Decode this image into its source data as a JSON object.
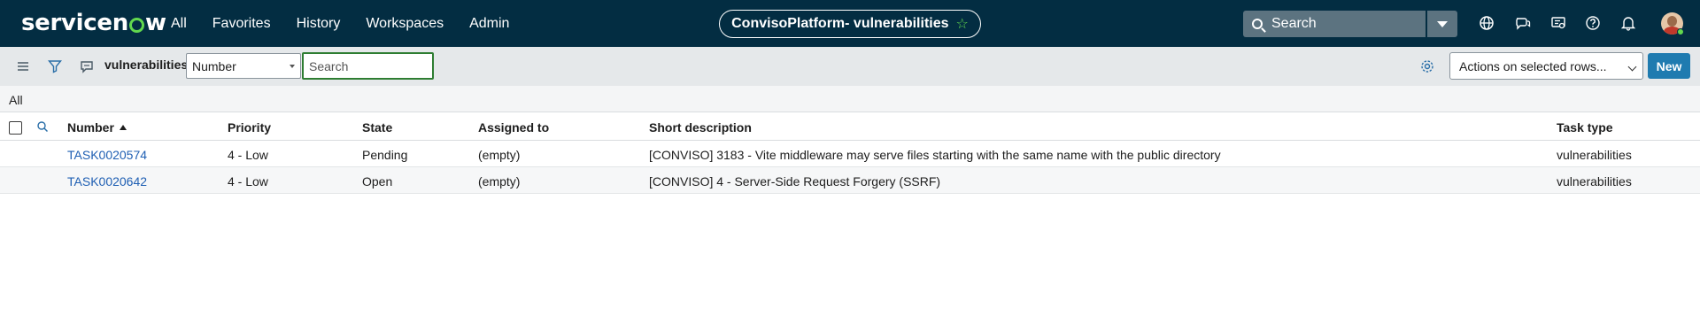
{
  "header": {
    "logo_prefix": "servicen",
    "logo_suffix": "w",
    "nav": [
      {
        "label": "All"
      },
      {
        "label": "Favorites"
      },
      {
        "label": "History"
      },
      {
        "label": "Workspaces"
      },
      {
        "label": "Admin"
      }
    ],
    "scope_title": "ConvisoPlatform- vulnerabilities",
    "scope_star": "☆",
    "search_placeholder": "Search",
    "icons": [
      "globe-icon",
      "chat-icon",
      "screen-share-icon",
      "help-icon",
      "bell-icon"
    ]
  },
  "toolbar": {
    "list_title": "vulnerabilities",
    "field_select_value": "Number",
    "search_placeholder": "Search",
    "actions_select": "Actions on selected rows...",
    "new_label": "New"
  },
  "breadcrumb": {
    "label": "All"
  },
  "table": {
    "columns": [
      "Number",
      "Priority",
      "State",
      "Assigned to",
      "Short description",
      "Task type"
    ],
    "rows": [
      {
        "number": "TASK0020574",
        "priority": "4 - Low",
        "state": "Pending",
        "assigned_to": "(empty)",
        "short_description": "[CONVISO] 3183 - Vite middleware may serve files starting with the same name with the public directory",
        "task_type": "vulnerabilities"
      },
      {
        "number": "TASK0020642",
        "priority": "4 - Low",
        "state": "Open",
        "assigned_to": "(empty)",
        "short_description": "[CONVISO] 4 - Server-Side Request Forgery (SSRF)",
        "task_type": "vulnerabilities"
      }
    ]
  },
  "colors": {
    "header_bg": "#032d42",
    "accent_green": "#62d84e",
    "link_blue": "#1f5fb3",
    "new_button": "#1f7bb0"
  }
}
